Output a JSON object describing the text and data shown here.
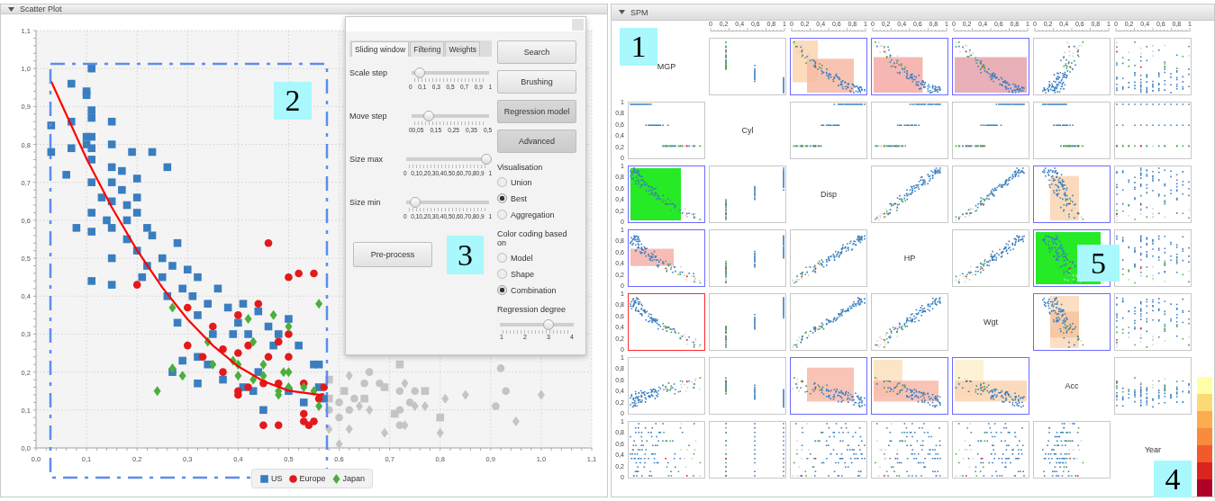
{
  "scatter_panel": {
    "title": "Scatter Plot",
    "callout": "2",
    "chart_data": {
      "type": "scatter",
      "grid": true,
      "legend": "bottom",
      "xlim": [
        0,
        1.1
      ],
      "ylim": [
        0,
        1.1
      ],
      "xticks": [
        {
          "value": 0,
          "label": "0,0"
        },
        {
          "value": 0.1,
          "label": "0,1"
        },
        {
          "value": 0.2,
          "label": "0,2"
        },
        {
          "value": 0.3,
          "label": "0,3"
        },
        {
          "value": 0.4,
          "label": "0,4"
        },
        {
          "value": 0.5,
          "label": "0,5"
        },
        {
          "value": 0.6,
          "label": "0,6"
        },
        {
          "value": 0.7,
          "label": "0,7"
        },
        {
          "value": 0.8,
          "label": "0,8"
        },
        {
          "value": 0.9,
          "label": "0,9"
        },
        {
          "value": 1,
          "label": "1,0"
        },
        {
          "value": 1.1,
          "label": "1,1"
        }
      ],
      "yticks": [
        {
          "value": 0,
          "label": "0,0"
        },
        {
          "value": 0.1,
          "label": "0,1"
        },
        {
          "value": 0.2,
          "label": "0,2"
        },
        {
          "value": 0.3,
          "label": "0,3"
        },
        {
          "value": 0.4,
          "label": "0,4"
        },
        {
          "value": 0.5,
          "label": "0,5"
        },
        {
          "value": 0.6,
          "label": "0,6"
        },
        {
          "value": 0.7,
          "label": "0,7"
        },
        {
          "value": 0.8,
          "label": "0,8"
        },
        {
          "value": 0.9,
          "label": "0,9"
        },
        {
          "value": 1,
          "label": "1,0"
        },
        {
          "value": 1.1,
          "label": "1,1"
        }
      ],
      "series": [
        {
          "color": "#c4c4c4",
          "marker": "circle",
          "x": [
            0.6,
            0.62,
            0.65,
            0.68,
            0.72,
            0.72,
            0.75,
            0.74,
            0.91,
            0.93,
            0.6,
            0.63,
            0.58,
            0.66,
            0.72,
            0.92
          ],
          "values": [
            0.12,
            0.1,
            0.17,
            0.17,
            0.1,
            0.06,
            0.15,
            0.12,
            0.11,
            0.15,
            0.08,
            0.13,
            0.1,
            0.2,
            0.15,
            0.21
          ]
        },
        {
          "color": "#c4c4c4",
          "marker": "diamond",
          "x": [
            0.62,
            0.64,
            0.66,
            0.69,
            0.73,
            0.75,
            0.77,
            0.8,
            0.81,
            0.85,
            0.95,
            1.0,
            0.58,
            0.6,
            0.62,
            0.73
          ],
          "values": [
            0.05,
            0.11,
            0.1,
            0.04,
            0.17,
            0.11,
            0.11,
            0.04,
            0.13,
            0.14,
            0.07,
            0.14,
            0.05,
            0.01,
            0.19,
            0.06
          ]
        },
        {
          "color": "#c4c4c4",
          "marker": "square",
          "x": [
            0.58,
            0.61,
            0.65,
            0.69,
            0.71,
            0.72,
            0.77,
            0.8,
            0.58
          ],
          "values": [
            0.18,
            0.15,
            0.13,
            0.16,
            0.09,
            0.22,
            0.15,
            0.08,
            0.13
          ]
        },
        {
          "name": "US",
          "color": "#3a7ebf",
          "marker": "square",
          "x": [
            0.03,
            0.03,
            0.07,
            0.07,
            0.07,
            0.1,
            0.1,
            0.1,
            0.1,
            0.11,
            0.11,
            0.11,
            0.11,
            0.11,
            0.11,
            0.11,
            0.11,
            0.11,
            0.11,
            0.13,
            0.14,
            0.15,
            0.15,
            0.15,
            0.15,
            0.15,
            0.15,
            0.15,
            0.15,
            0.17,
            0.17,
            0.18,
            0.18,
            0.18,
            0.19,
            0.2,
            0.2,
            0.2,
            0.2,
            0.21,
            0.22,
            0.22,
            0.23,
            0.23,
            0.25,
            0.25,
            0.26,
            0.26,
            0.27,
            0.28,
            0.28,
            0.29,
            0.3,
            0.31,
            0.32,
            0.32,
            0.34,
            0.35,
            0.36,
            0.38,
            0.4,
            0.41,
            0.42,
            0.44,
            0.46,
            0.48,
            0.5,
            0.52,
            0.55,
            0.56,
            0.29,
            0.32,
            0.32,
            0.37,
            0.41,
            0.43,
            0.44,
            0.45,
            0.5,
            0.53,
            0.56,
            0.57,
            0.27,
            0.34,
            0.39,
            0.47,
            0.08,
            0.06
          ],
          "values": [
            0.85,
            0.78,
            0.96,
            0.86,
            0.79,
            0.94,
            0.93,
            0.82,
            0.8,
            1.0,
            0.89,
            0.87,
            0.82,
            0.79,
            0.76,
            0.7,
            0.62,
            0.57,
            0.44,
            0.66,
            0.6,
            0.86,
            0.8,
            0.74,
            0.7,
            0.65,
            0.58,
            0.5,
            0.43,
            0.73,
            0.68,
            0.64,
            0.6,
            0.55,
            0.78,
            0.71,
            0.66,
            0.62,
            0.52,
            0.45,
            0.58,
            0.48,
            0.78,
            0.56,
            0.5,
            0.45,
            0.74,
            0.4,
            0.48,
            0.54,
            0.33,
            0.42,
            0.47,
            0.4,
            0.35,
            0.45,
            0.38,
            0.3,
            0.42,
            0.37,
            0.33,
            0.38,
            0.3,
            0.36,
            0.32,
            0.3,
            0.34,
            0.27,
            0.22,
            0.22,
            0.23,
            0.24,
            0.17,
            0.18,
            0.16,
            0.15,
            0.2,
            0.1,
            0.15,
            0.12,
            0.16,
            0.13,
            0.2,
            0.22,
            0.3,
            0.27,
            0.58,
            0.72
          ]
        },
        {
          "name": "Europe",
          "color": "#e4191c",
          "marker": "circle",
          "x": [
            0.46,
            0.5,
            0.52,
            0.55,
            0.2,
            0.3,
            0.35,
            0.4,
            0.42,
            0.44,
            0.37,
            0.3,
            0.33,
            0.4,
            0.46,
            0.48,
            0.5,
            0.4,
            0.4,
            0.42,
            0.45,
            0.48,
            0.5,
            0.53,
            0.53,
            0.53,
            0.45,
            0.48,
            0.54,
            0.55,
            0.56,
            0.57,
            0.37
          ],
          "values": [
            0.54,
            0.45,
            0.46,
            0.46,
            0.43,
            0.37,
            0.32,
            0.35,
            0.27,
            0.38,
            0.26,
            0.27,
            0.24,
            0.25,
            0.24,
            0.28,
            0.3,
            0.15,
            0.14,
            0.16,
            0.17,
            0.17,
            0.24,
            0.17,
            0.09,
            0.07,
            0.06,
            0.06,
            0.06,
            0.07,
            0.13,
            0.16,
            0.2
          ]
        },
        {
          "name": "Japan",
          "color": "#4bae3d",
          "marker": "diamond",
          "x": [
            0.24,
            0.27,
            0.29,
            0.35,
            0.27,
            0.34,
            0.39,
            0.4,
            0.4,
            0.43,
            0.45,
            0.45,
            0.48,
            0.48,
            0.49,
            0.5,
            0.5,
            0.53,
            0.55,
            0.56,
            0.47,
            0.5,
            0.42,
            0.43,
            0.56
          ],
          "values": [
            0.15,
            0.21,
            0.19,
            0.22,
            0.37,
            0.28,
            0.23,
            0.22,
            0.19,
            0.18,
            0.22,
            0.19,
            0.15,
            0.14,
            0.2,
            0.2,
            0.16,
            0.16,
            0.15,
            0.11,
            0.35,
            0.32,
            0.34,
            0.28,
            0.38
          ]
        },
        {
          "type": "line",
          "color": "#ff0000",
          "x": [
            0.03,
            0.1,
            0.15,
            0.2,
            0.25,
            0.3,
            0.35,
            0.4,
            0.45,
            0.5,
            0.56,
            0.57
          ],
          "values": [
            0.966,
            0.762,
            0.634,
            0.521,
            0.423,
            0.339,
            0.27,
            0.215,
            0.176,
            0.151,
            0.14,
            0.142
          ]
        }
      ]
    }
  },
  "tool_window": {
    "callout": "3",
    "tabs": [
      {
        "label": "Sliding window",
        "selected": true
      },
      {
        "label": "Filtering",
        "selected": false
      },
      {
        "label": "Weights",
        "selected": false
      }
    ],
    "sliders": [
      {
        "label": "Scale step",
        "level": 0.08,
        "scale": "0 0,1 0,3 0,5 0,7 0,9 1"
      },
      {
        "label": "Move step",
        "level": 0.2,
        "scale": "00,05 0,15 0,25 0,35 0,5"
      },
      {
        "label": "Size max",
        "level": 1,
        "scale": "0 0,10,20,30,40,50,60,70,80,9 1"
      },
      {
        "label": "Size min",
        "level": 0.08,
        "scale": "0 0,10,20,30,40,50,60,70,80,9 1"
      }
    ],
    "preprocess_button": "Pre-process",
    "buttons": [
      {
        "label": "Search",
        "pressed": false
      },
      {
        "label": "Brushing",
        "pressed": false
      },
      {
        "label": "Regression model",
        "pressed": true
      },
      {
        "label": "Advanced",
        "pressed": true
      }
    ],
    "groups": [
      {
        "title": "Visualisation",
        "options": [
          {
            "label": "Union",
            "selected": false
          },
          {
            "label": "Best",
            "selected": true
          },
          {
            "label": "Aggregation",
            "selected": false
          }
        ]
      },
      {
        "title": "Color coding based on",
        "options": [
          {
            "label": "Model",
            "selected": false
          },
          {
            "label": "Shape",
            "selected": false
          },
          {
            "label": "Combination",
            "selected": true
          }
        ]
      }
    ],
    "degree": {
      "label": "Regression degree",
      "level": 0.667,
      "ticks": [
        "1",
        "2",
        "3",
        "4"
      ]
    }
  },
  "spm": {
    "title": "SPM",
    "callouts": [
      "1",
      "5",
      "4"
    ],
    "column_ticks": [
      {
        "labels": [
          "0",
          "0,2",
          "0,4",
          "0,6",
          "0,8",
          "1"
        ]
      },
      {
        "labels": [
          "0",
          "0,2",
          "0,4",
          "0,6",
          "0,8",
          "1"
        ]
      },
      {
        "labels": [
          "0",
          "0,2",
          "0,4",
          "0,6",
          "0,8",
          "1"
        ]
      },
      {
        "labels": [
          "0",
          "0,2",
          "0,4",
          "0,6",
          "0,8",
          "1"
        ]
      },
      {
        "labels": [
          "0",
          "0,2",
          "0,4",
          "0,6",
          "0,8",
          "1"
        ]
      },
      {
        "labels": [
          "0",
          "0,2",
          "0,4",
          "0,6",
          "0,8",
          "1"
        ]
      }
    ],
    "rows": [
      {
        "cells": [
          {
            "kind": "label",
            "text": "MGP"
          },
          {
            "kind": "scatter"
          },
          {
            "kind": "scatter",
            "color": "#6b6bff"
          },
          {
            "kind": "scatter",
            "color": "#6b6bff"
          },
          {
            "kind": "scatter",
            "color": "#6b6bff"
          },
          {
            "kind": "scatter"
          },
          {
            "kind": "scatter"
          }
        ]
      },
      {
        "ticks": [
          "1",
          "0,8",
          "0,6",
          "0,4",
          "0,2",
          "0"
        ],
        "cells": [
          {
            "kind": "scatter"
          },
          {
            "kind": "label",
            "text": "Cyl"
          },
          {
            "kind": "scatter"
          },
          {
            "kind": "scatter"
          },
          {
            "kind": "scatter"
          },
          {
            "kind": "scatter"
          },
          {
            "kind": "scatter"
          }
        ]
      },
      {
        "ticks": [
          "1",
          "0,8",
          "0,6",
          "0,4",
          "0,2",
          "0"
        ],
        "cells": [
          {
            "kind": "scatter",
            "color": "#6b6bff"
          },
          {
            "kind": "scatter"
          },
          {
            "kind": "label",
            "text": "Disp"
          },
          {
            "kind": "scatter"
          },
          {
            "kind": "scatter"
          },
          {
            "kind": "scatter",
            "color": "#6b6bff"
          },
          {
            "kind": "scatter"
          }
        ]
      },
      {
        "ticks": [
          "1",
          "0,8",
          "0,6",
          "0,4",
          "0,2",
          "0"
        ],
        "cells": [
          {
            "kind": "scatter",
            "color": "#6b6bff"
          },
          {
            "kind": "scatter"
          },
          {
            "kind": "scatter"
          },
          {
            "kind": "label",
            "text": "HP"
          },
          {
            "kind": "scatter"
          },
          {
            "kind": "scatter",
            "color": "#6b6bff"
          },
          {
            "kind": "scatter"
          }
        ]
      },
      {
        "ticks": [
          "1",
          "0,8",
          "0,6",
          "0,4",
          "0,2",
          "0"
        ],
        "cells": [
          {
            "kind": "scatter",
            "color": "#ff2a2a"
          },
          {
            "kind": "scatter"
          },
          {
            "kind": "scatter"
          },
          {
            "kind": "scatter"
          },
          {
            "kind": "label",
            "text": "Wgt"
          },
          {
            "kind": "scatter",
            "color": "#6b6bff"
          },
          {
            "kind": "scatter"
          }
        ]
      },
      {
        "ticks": [
          "1",
          "0,8",
          "0,6",
          "0,4",
          "0,2",
          "0"
        ],
        "cells": [
          {
            "kind": "scatter"
          },
          {
            "kind": "scatter"
          },
          {
            "kind": "scatter",
            "color": "#6b6bff"
          },
          {
            "kind": "scatter",
            "color": "#6b6bff"
          },
          {
            "kind": "scatter",
            "color": "#6b6bff"
          },
          {
            "kind": "label",
            "text": "Acc"
          },
          {
            "kind": "scatter"
          }
        ]
      },
      {
        "ticks": [
          "1",
          "0,8",
          "0,6",
          "0,4",
          "0,2",
          "0"
        ],
        "cells": [
          {
            "kind": "scatter"
          },
          {
            "kind": "scatter"
          },
          {
            "kind": "scatter"
          },
          {
            "kind": "scatter"
          },
          {
            "kind": "scatter"
          },
          {
            "kind": "scatter"
          },
          {
            "kind": "label",
            "text": "Year"
          }
        ]
      }
    ],
    "color_scale": [
      {
        "color": "#ffffa8"
      },
      {
        "color": "#fdd976"
      },
      {
        "color": "#fcad4f"
      },
      {
        "color": "#f98a3e"
      },
      {
        "color": "#f35a2b"
      },
      {
        "color": "#dc241f"
      },
      {
        "color": "#b00026"
      }
    ]
  }
}
